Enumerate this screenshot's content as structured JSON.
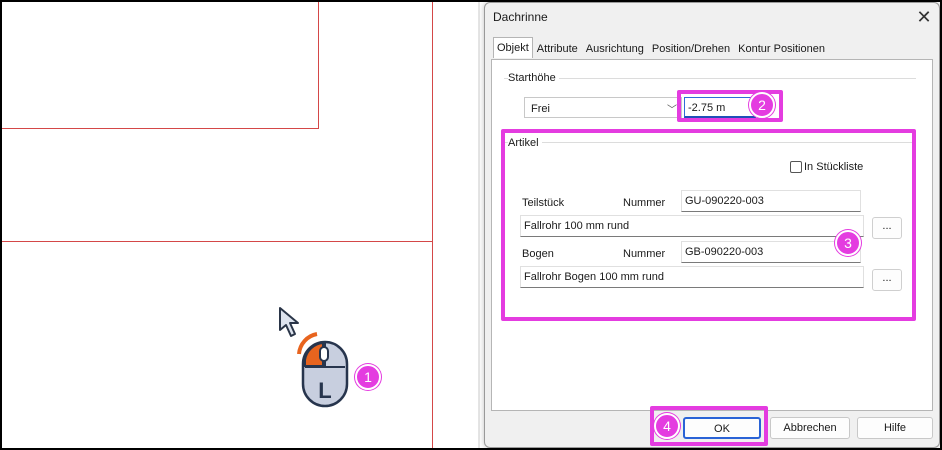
{
  "dialog": {
    "title": "Dachrinne",
    "close_icon": "close-icon",
    "tabs": [
      "Objekt",
      "Attribute",
      "Ausrichtung",
      "Position/Drehen",
      "Kontur Positionen"
    ],
    "active_tab": "Objekt",
    "starthoehe": {
      "group_label": "Starthöhe",
      "mode_value": "Frei",
      "height_value": "-2.75 m"
    },
    "artikel": {
      "group_label": "Artikel",
      "stueckliste_label": "In Stückliste",
      "stueckliste_checked": false,
      "teilstueck": {
        "label": "Teilstück",
        "nummer_label": "Nummer",
        "nummer_value": "GU-090220-003",
        "description": "Fallrohr 100 mm rund",
        "browse_label": "..."
      },
      "bogen": {
        "label": "Bogen",
        "nummer_label": "Nummer",
        "nummer_value": "GB-090220-003",
        "description": "Fallrohr Bogen 100 mm rund",
        "browse_label": "..."
      }
    },
    "buttons": {
      "ok": "OK",
      "cancel": "Abbrechen",
      "help": "Hilfe"
    }
  },
  "canvas": {
    "cursor_icon": "arrow-cursor-icon",
    "mouse_icon": "mouse-left-click-icon",
    "mouse_letter": "L"
  },
  "callouts": [
    "1",
    "2",
    "3",
    "4"
  ],
  "colors": {
    "callout": "#e43ce0",
    "cad_line": "#d44848",
    "ok_border": "#2a63d6"
  }
}
